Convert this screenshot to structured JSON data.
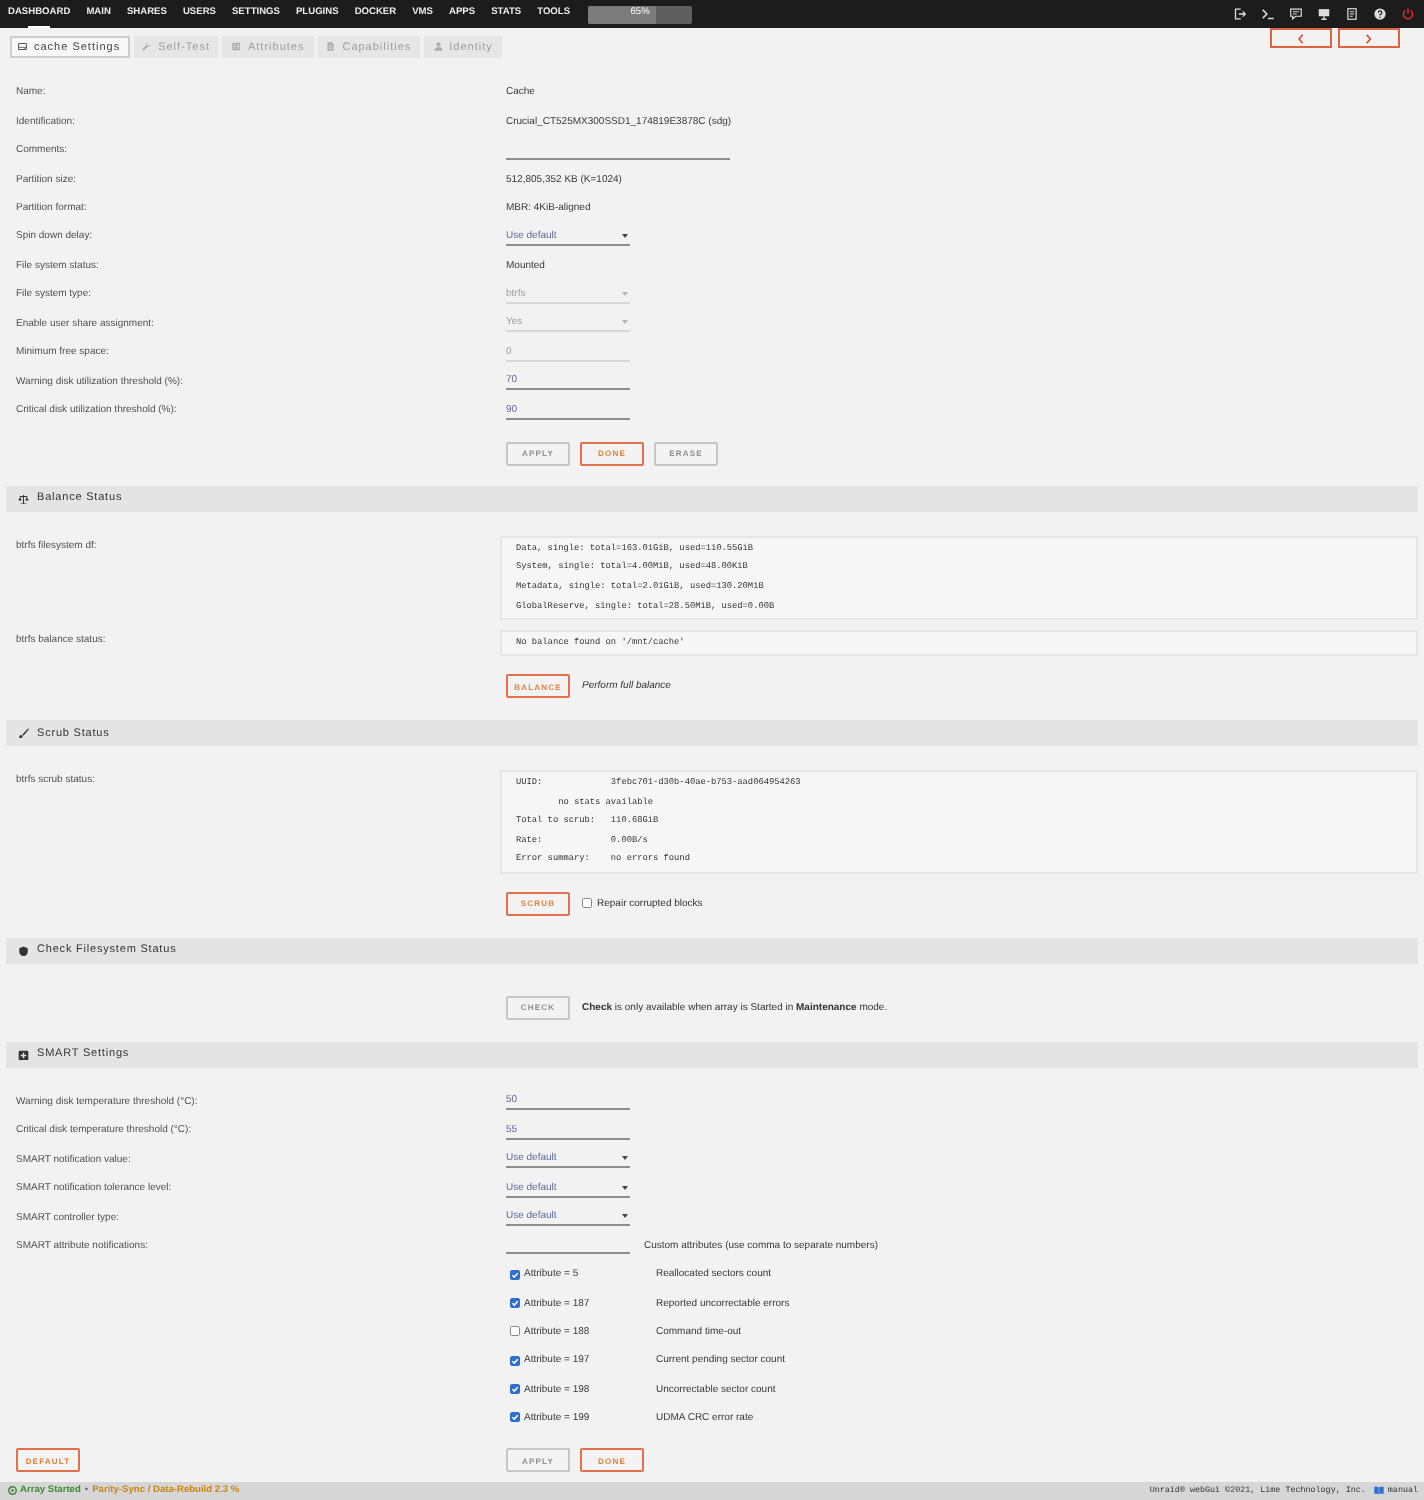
{
  "top_nav": {
    "items": [
      {
        "label": "DASHBOARD",
        "selected": true
      },
      {
        "label": "MAIN",
        "selected": false
      },
      {
        "label": "SHARES",
        "selected": false
      },
      {
        "label": "USERS",
        "selected": false
      },
      {
        "label": "SETTINGS",
        "selected": false
      },
      {
        "label": "PLUGINS",
        "selected": false
      },
      {
        "label": "DOCKER",
        "selected": false
      },
      {
        "label": "VMS",
        "selected": false
      },
      {
        "label": "APPS",
        "selected": false
      },
      {
        "label": "STATS",
        "selected": false
      },
      {
        "label": "TOOLS",
        "selected": false
      }
    ],
    "usage": {
      "level": 0.65,
      "reading": "65%"
    }
  },
  "tabs": [
    {
      "label": "cache Settings",
      "selected": true
    },
    {
      "label": "Self-Test",
      "selected": false
    },
    {
      "label": "Attributes",
      "selected": false
    },
    {
      "label": "Capabilities",
      "selected": false
    },
    {
      "label": "Identity",
      "selected": false
    }
  ],
  "disk_settings": {
    "rows": [
      {
        "kind": "text",
        "label": "Name:",
        "value": "Cache"
      },
      {
        "kind": "text",
        "label": "Identification:",
        "value": "Crucial_CT525MX300SSD1_174819E3878C (sdg)"
      },
      {
        "kind": "wide_input",
        "label": "Comments:",
        "disabled": false
      },
      {
        "kind": "text",
        "label": "Partition size:",
        "value": "512,805,352 KB (K=1024)"
      },
      {
        "kind": "text",
        "label": "Partition format:",
        "value": "MBR: 4KiB-aligned"
      },
      {
        "kind": "select",
        "label": "Spin down delay:",
        "value": "Use default",
        "disabled": false
      },
      {
        "kind": "text",
        "label": "File system status:",
        "value": "Mounted"
      },
      {
        "kind": "select",
        "label": "File system type:",
        "value": "btrfs",
        "disabled": true
      },
      {
        "kind": "select",
        "label": "Enable user share assignment:",
        "value": "Yes",
        "disabled": true
      },
      {
        "kind": "input",
        "label": "Minimum free space:",
        "value": "0",
        "disabled": true
      },
      {
        "kind": "input",
        "label": "Warning disk utilization threshold (%):",
        "value": "70",
        "disabled": false
      },
      {
        "kind": "input",
        "label": "Critical disk utilization threshold (%):",
        "value": "90",
        "disabled": false
      }
    ],
    "buttons": [
      {
        "label": "APPLY",
        "disabled": true
      },
      {
        "label": "DONE",
        "disabled": false
      },
      {
        "label": "ERASE",
        "disabled": true
      }
    ]
  },
  "balance_status": {
    "title": "Balance Status",
    "rows": [
      {
        "label": "btrfs filesystem df:",
        "lines": [
          "Data, single: total=163.01GiB, used=110.55GiB",
          "System, single: total=4.00MiB, used=48.00KiB",
          "Metadata, single: total=2.01GiB, used=130.20MiB",
          "GlobalReserve, single: total=28.50MiB, used=0.00B"
        ]
      },
      {
        "label": "btrfs balance status:",
        "lines": [
          "No balance found on '/mnt/cache'"
        ]
      }
    ],
    "button": {
      "label": "BALANCE",
      "disabled": false
    },
    "note": "Perform full balance"
  },
  "scrub_status": {
    "title": "Scrub Status",
    "rows": [
      {
        "label": "btrfs scrub status:",
        "lines": [
          "UUID:             3febc701-d30b-40ae-b753-aad064954263",
          "        no stats available",
          "Total to scrub:   110.68GiB",
          "Rate:             0.00B/s",
          "Error summary:    no errors found"
        ]
      }
    ],
    "button": {
      "label": "SCRUB",
      "disabled": false
    },
    "option": {
      "label": "Repair corrupted blocks",
      "checked": false
    }
  },
  "check_filesystem_status": {
    "title": "Check Filesystem Status",
    "button": {
      "label": "CHECK",
      "disabled": true
    },
    "note": "**Check** is only available when array is Started in **Maintenance** mode."
  },
  "smart_settings": {
    "title": "SMART Settings",
    "rows": [
      {
        "kind": "input",
        "label": "Warning disk temperature threshold (°C):",
        "value": "50",
        "disabled": false
      },
      {
        "kind": "input",
        "label": "Critical disk temperature threshold (°C):",
        "value": "55",
        "disabled": false
      },
      {
        "kind": "select",
        "label": "SMART notification value:",
        "value": "Use default",
        "disabled": false
      },
      {
        "kind": "select",
        "label": "SMART notification tolerance level:",
        "value": "Use default",
        "disabled": false
      },
      {
        "kind": "select",
        "label": "SMART controller type:",
        "value": "Use default",
        "disabled": false
      },
      {
        "kind": "input",
        "label": "SMART attribute notifications:",
        "disabled": false,
        "note": "Custom attributes (use comma to separate numbers)"
      }
    ],
    "attributes": [
      {
        "label": "Attribute = 5",
        "description": "Reallocated sectors count",
        "checked": true
      },
      {
        "label": "Attribute = 187",
        "description": "Reported uncorrectable errors",
        "checked": true
      },
      {
        "label": "Attribute = 188",
        "description": "Command time-out",
        "checked": false
      },
      {
        "label": "Attribute = 197",
        "description": "Current pending sector count",
        "checked": true
      },
      {
        "label": "Attribute = 198",
        "description": "Uncorrectable sector count",
        "checked": true
      },
      {
        "label": "Attribute = 199",
        "description": "UDMA CRC error rate",
        "checked": true
      }
    ],
    "reset_button": {
      "label": "DEFAULT",
      "disabled": false
    },
    "buttons": [
      {
        "label": "APPLY",
        "disabled": true
      },
      {
        "label": "DONE",
        "disabled": false
      }
    ]
  },
  "status_bar": {
    "array_status": "Array Started",
    "separator": "•",
    "activity": "Parity-Sync / Data-Rebuild 2.3 %",
    "copyright": "Unraid® webGui ©2021, Lime Technology, Inc.",
    "manual": "manual"
  }
}
